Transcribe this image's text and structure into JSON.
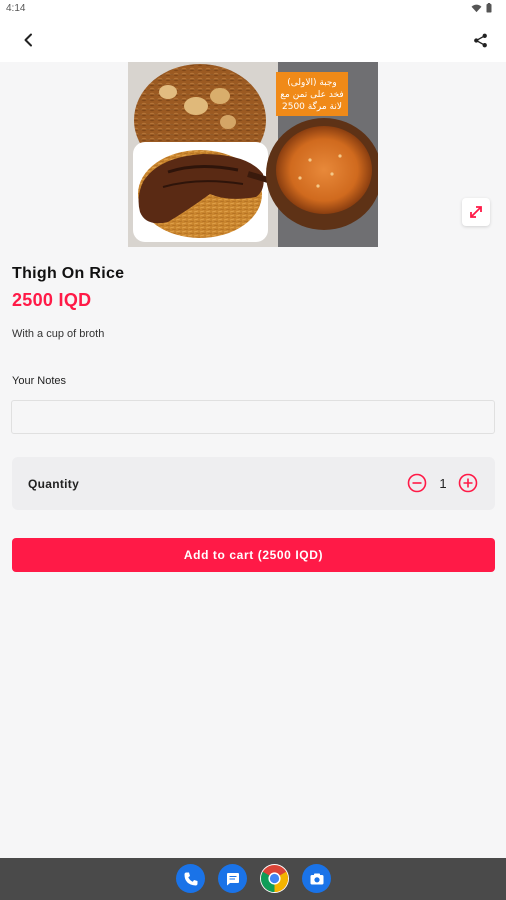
{
  "status_bar": {
    "time": "4:14"
  },
  "app_bar": {
    "back_icon": "arrow-back-icon",
    "share_icon": "share-icon"
  },
  "product": {
    "image_alt": "Thigh On Rice",
    "image_overlay_lines": [
      "وجبة (الاولى)",
      "فخد على تمن مع",
      "لانة مرگة 2500"
    ],
    "name": "Thigh On Rice",
    "price": "2500 IQD",
    "description": "With a cup of broth"
  },
  "notes": {
    "label": "Your Notes",
    "value": "",
    "placeholder": ""
  },
  "quantity": {
    "label": "Quantity",
    "value": "1"
  },
  "cta": {
    "add_to_cart_label": "Add to cart (2500 IQD)"
  },
  "dock": {
    "apps": [
      {
        "name": "phone-app-icon",
        "color": "#1a73e8"
      },
      {
        "name": "messages-app-icon",
        "color": "#1a73e8"
      },
      {
        "name": "chrome-app-icon",
        "color": "#ffffff"
      },
      {
        "name": "camera-app-icon",
        "color": "#1a73e8"
      }
    ]
  },
  "colors": {
    "accent": "#ff1a47",
    "background": "#f6f6f7"
  }
}
